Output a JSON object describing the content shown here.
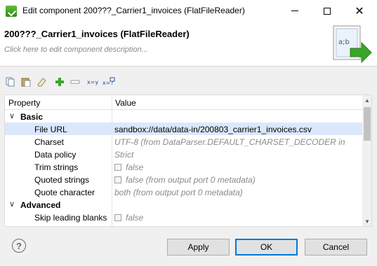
{
  "window": {
    "title": "Edit component 200???_Carrier1_invoices (FlatFileReader)",
    "minimize_icon": "minimize-icon",
    "maximize_icon": "maximize-icon",
    "close_icon": "close-icon"
  },
  "header": {
    "component_title": "200???_Carrier1_invoices (FlatFileReader)",
    "description_placeholder": "Click here to edit component description...",
    "badge_text": "a;b",
    "badge_icon": "flat-file-reader-icon"
  },
  "toolbar": {
    "icons": [
      "copy-icon",
      "paste-icon",
      "clear-icon",
      "add-icon",
      "remove-icon",
      "edit-expression-icon",
      "edit-mapping-icon"
    ],
    "expr_label": "x=y",
    "map_label": "x=?"
  },
  "table": {
    "header_property": "Property",
    "header_value": "Value",
    "group_basic": "Basic",
    "group_advanced": "Advanced",
    "rows": {
      "file_url": {
        "name": "File URL",
        "value": "sandbox://data/data-in/200803_carrier1_invoices.csv"
      },
      "charset": {
        "name": "Charset",
        "value": "UTF-8 (from DataParser.DEFAULT_CHARSET_DECODER in"
      },
      "data_policy": {
        "name": "Data policy",
        "value": "Strict"
      },
      "trim_strings": {
        "name": "Trim strings",
        "value": "false"
      },
      "quoted_strings": {
        "name": "Quoted strings",
        "value": "false (from output port 0 metadata)"
      },
      "quote_character": {
        "name": "Quote character",
        "value": "both (from output port 0 metadata)"
      },
      "skip_leading_blanks": {
        "name": "Skip leading blanks",
        "value": "false"
      }
    }
  },
  "buttons": {
    "help": "?",
    "apply": "Apply",
    "ok": "OK",
    "cancel": "Cancel"
  },
  "colors": {
    "selection": "#dbe8fb",
    "default_button_border": "#0078d7",
    "arrow_green": "#3aa629"
  }
}
